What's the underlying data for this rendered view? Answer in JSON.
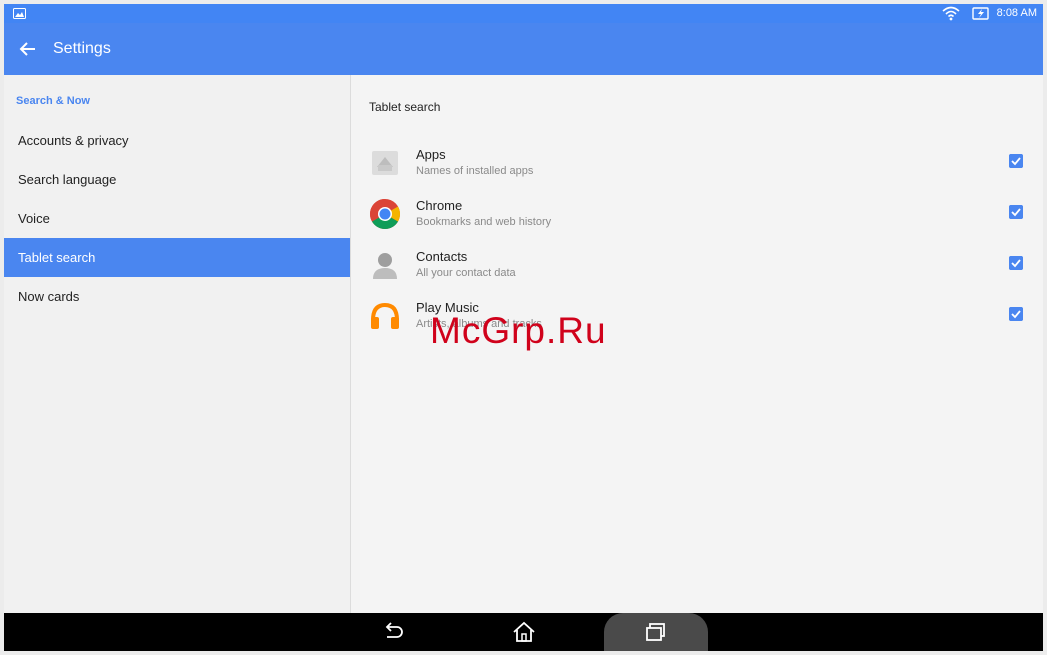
{
  "status_bar": {
    "time": "8:08 AM"
  },
  "app_bar": {
    "title": "Settings"
  },
  "sidebar": {
    "header": "Search & Now",
    "items": [
      {
        "label": "Accounts & privacy"
      },
      {
        "label": "Search language"
      },
      {
        "label": "Voice"
      },
      {
        "label": "Tablet search",
        "active": true
      },
      {
        "label": "Now cards"
      }
    ]
  },
  "main": {
    "section_title": "Tablet search",
    "rows": [
      {
        "label": "Apps",
        "sub": "Names of installed apps",
        "checked": true,
        "icon": "apps-icon"
      },
      {
        "label": "Chrome",
        "sub": "Bookmarks and web history",
        "checked": true,
        "icon": "chrome-icon"
      },
      {
        "label": "Contacts",
        "sub": "All your contact data",
        "checked": true,
        "icon": "contacts-icon"
      },
      {
        "label": "Play Music",
        "sub": "Artists, albums and tracks",
        "checked": true,
        "icon": "play-music-icon"
      }
    ]
  },
  "watermark": "McGrp.Ru",
  "colors": {
    "accent": "#4a86f0",
    "statusbar": "#4285f4"
  }
}
